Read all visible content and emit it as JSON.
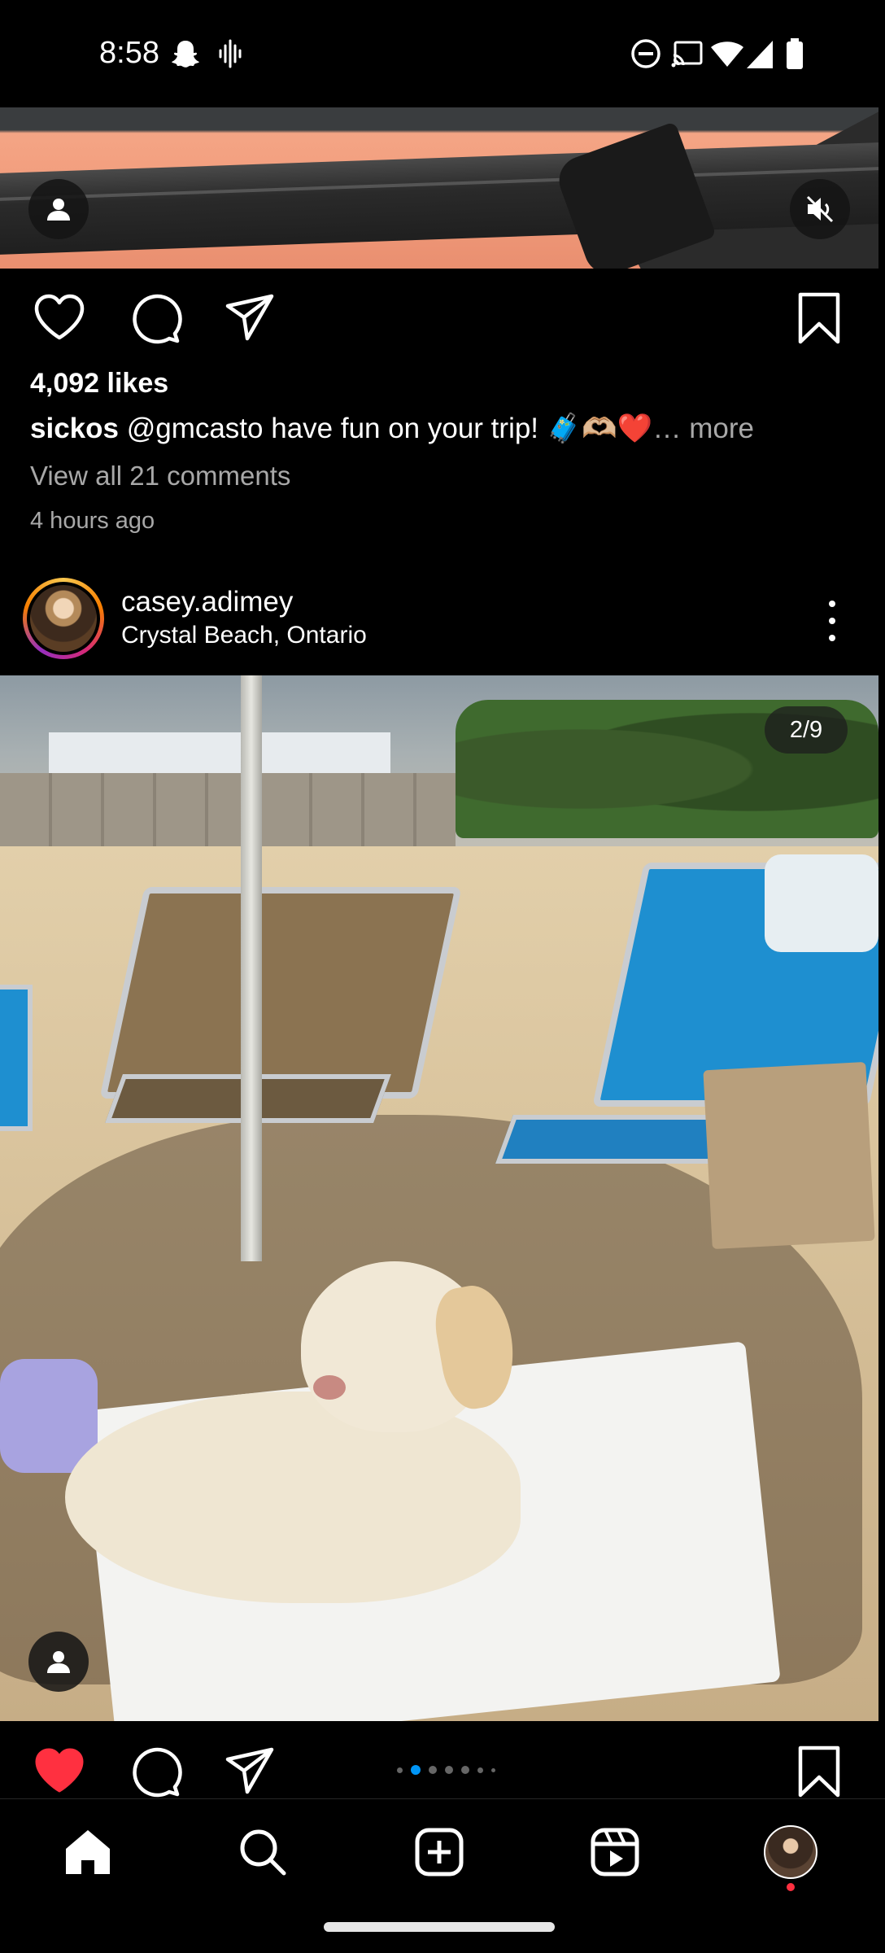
{
  "status_bar": {
    "time": "8:58",
    "left_icons": [
      "snapchat-icon",
      "voice-icon"
    ],
    "right_icons": [
      "do-not-disturb-icon",
      "cast-icon",
      "wifi-icon",
      "signal-icon",
      "battery-icon"
    ]
  },
  "post_top": {
    "icons": [
      "user-tag-icon",
      "mute-icon"
    ],
    "likes": "4,092 likes",
    "caption_user": "sickos",
    "caption_text": " @gmcasto have fun on your trip! 🧳🫶🏼❤️",
    "caption_more": "… more",
    "view_comments": "View all 21 comments",
    "time_ago": "4 hours ago",
    "actions": [
      "heart-icon",
      "comment-icon",
      "share-icon",
      "bookmark-icon"
    ]
  },
  "post_main": {
    "username": "casey.adimey",
    "location": "Crystal Beach, Ontario",
    "carousel_counter": "2/9",
    "carousel_total": 9,
    "carousel_index": 2,
    "liked": true,
    "accent_color": "#0095f6",
    "like_color": "#ff3040"
  },
  "bottom_nav": {
    "items": [
      "home-icon",
      "search-icon",
      "create-icon",
      "reels-icon",
      "profile-avatar"
    ]
  }
}
